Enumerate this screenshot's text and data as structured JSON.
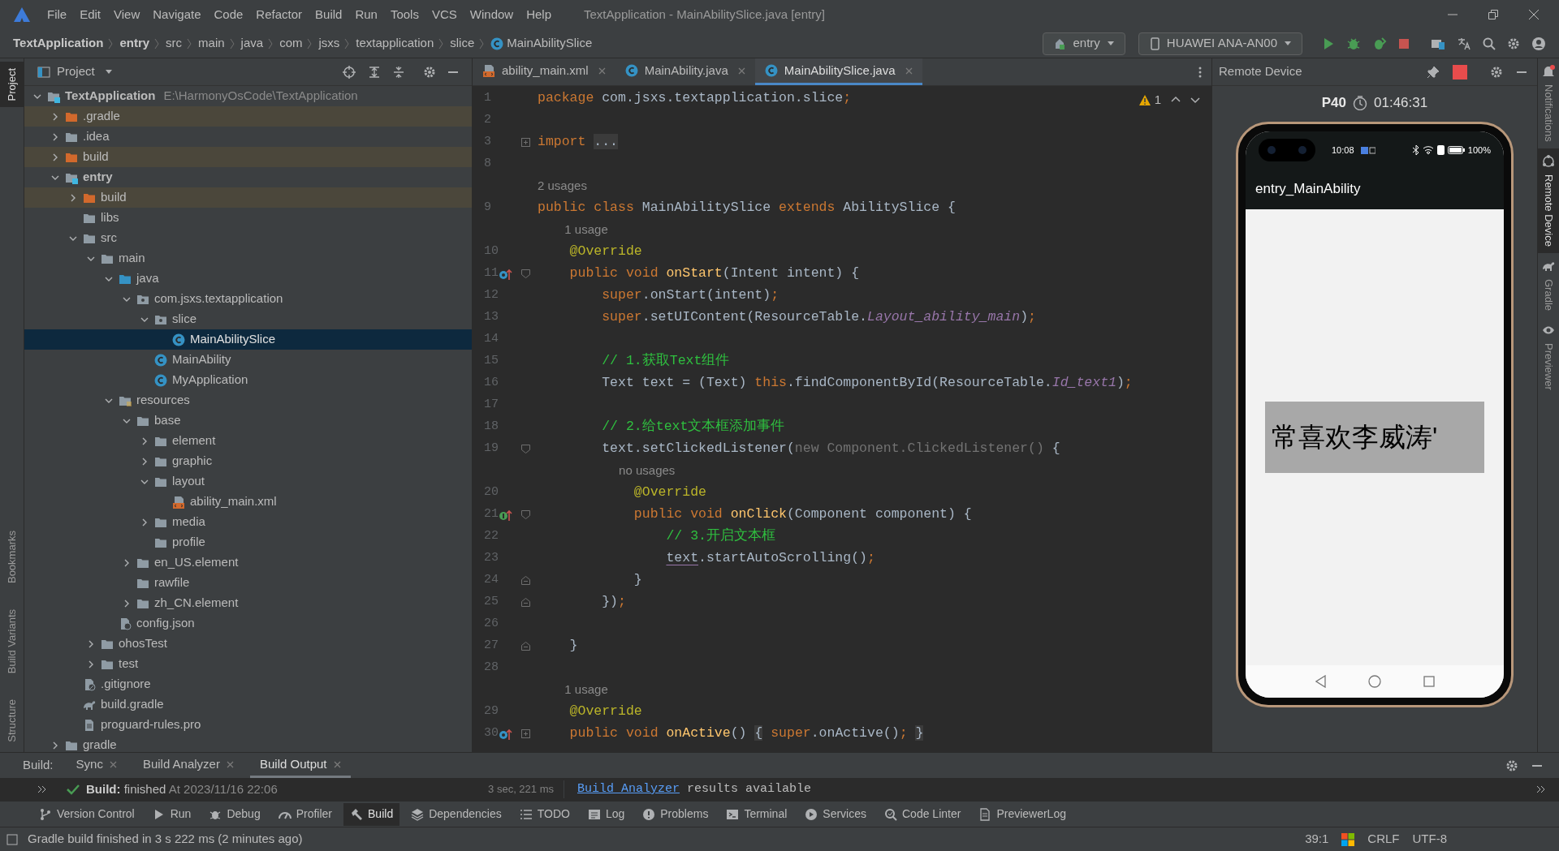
{
  "window_title": "TextApplication - MainAbilitySlice.java [entry]",
  "menu": [
    "File",
    "Edit",
    "View",
    "Navigate",
    "Code",
    "Refactor",
    "Build",
    "Run",
    "Tools",
    "VCS",
    "Window",
    "Help"
  ],
  "breadcrumb": [
    {
      "label": "TextApplication",
      "bold": true
    },
    {
      "label": "entry",
      "bold": true
    },
    {
      "label": "src",
      "bold": false
    },
    {
      "label": "main",
      "bold": false
    },
    {
      "label": "java",
      "bold": false
    },
    {
      "label": "com",
      "bold": false
    },
    {
      "label": "jsxs",
      "bold": false
    },
    {
      "label": "textapplication",
      "bold": false
    },
    {
      "label": "slice",
      "bold": false
    },
    {
      "label": "MainAbilitySlice",
      "bold": false,
      "kind": "class"
    }
  ],
  "run_config": "entry",
  "device": "HUAWEI ANA-AN00",
  "left_stripe_top": [
    {
      "label": "Project",
      "selected": true
    }
  ],
  "left_stripe_bottom": [
    {
      "label": "Bookmarks",
      "selected": false
    },
    {
      "label": "Build Variants",
      "selected": false
    },
    {
      "label": "Structure",
      "selected": false
    }
  ],
  "project_panel": {
    "title": "Project",
    "tree": [
      {
        "label": "TextApplication",
        "path": "E:\\HarmonyOsCode\\TextApplication",
        "kind": "module",
        "expanded": true,
        "selected": false,
        "children": [
          {
            "label": ".gradle",
            "kind": "excluded",
            "expanded": false,
            "selected": false
          },
          {
            "label": ".idea",
            "kind": "folder",
            "expanded": false,
            "selected": false
          },
          {
            "label": "build",
            "kind": "excluded",
            "expanded": false,
            "selected": false
          },
          {
            "label": "entry",
            "kind": "module",
            "expanded": true,
            "selected": false,
            "children": [
              {
                "label": "build",
                "kind": "excluded",
                "expanded": false,
                "selected": false
              },
              {
                "label": "libs",
                "kind": "folder",
                "selected": false
              },
              {
                "label": "src",
                "kind": "folder",
                "expanded": true,
                "selected": false,
                "children": [
                  {
                    "label": "main",
                    "kind": "folder",
                    "expanded": true,
                    "selected": false,
                    "children": [
                      {
                        "label": "java",
                        "kind": "source",
                        "expanded": true,
                        "selected": false,
                        "children": [
                          {
                            "label": "com.jsxs.textapplication",
                            "kind": "package",
                            "expanded": true,
                            "selected": false,
                            "children": [
                              {
                                "label": "slice",
                                "kind": "package",
                                "expanded": true,
                                "selected": false,
                                "children": [
                                  {
                                    "label": "MainAbilitySlice",
                                    "kind": "class",
                                    "selected": true
                                  }
                                ]
                              },
                              {
                                "label": "MainAbility",
                                "kind": "class",
                                "selected": false
                              },
                              {
                                "label": "MyApplication",
                                "kind": "class",
                                "selected": false
                              }
                            ]
                          }
                        ]
                      },
                      {
                        "label": "resources",
                        "kind": "resources",
                        "expanded": true,
                        "selected": false,
                        "children": [
                          {
                            "label": "base",
                            "kind": "folder",
                            "expanded": true,
                            "selected": false,
                            "children": [
                              {
                                "label": "element",
                                "kind": "folder",
                                "expanded": false,
                                "selected": false
                              },
                              {
                                "label": "graphic",
                                "kind": "folder",
                                "expanded": false,
                                "selected": false
                              },
                              {
                                "label": "layout",
                                "kind": "folder",
                                "expanded": true,
                                "selected": false,
                                "children": [
                                  {
                                    "label": "ability_main.xml",
                                    "kind": "xml",
                                    "selected": false
                                  }
                                ]
                              },
                              {
                                "label": "media",
                                "kind": "folder",
                                "expanded": false,
                                "selected": false
                              },
                              {
                                "label": "profile",
                                "kind": "folder",
                                "selected": false
                              }
                            ]
                          },
                          {
                            "label": "en_US.element",
                            "kind": "folder",
                            "expanded": false,
                            "selected": false
                          },
                          {
                            "label": "rawfile",
                            "kind": "folder",
                            "selected": false
                          },
                          {
                            "label": "zh_CN.element",
                            "kind": "folder",
                            "expanded": false,
                            "selected": false
                          }
                        ]
                      },
                      {
                        "label": "config.json",
                        "kind": "json",
                        "selected": false
                      }
                    ]
                  },
                  {
                    "label": "ohosTest",
                    "kind": "folder",
                    "expanded": false,
                    "selected": false
                  },
                  {
                    "label": "test",
                    "kind": "folder",
                    "expanded": false,
                    "selected": false
                  }
                ]
              },
              {
                "label": ".gitignore",
                "kind": "ignore",
                "selected": false
              },
              {
                "label": "build.gradle",
                "kind": "gradle",
                "selected": false
              },
              {
                "label": "proguard-rules.pro",
                "kind": "file",
                "selected": false
              }
            ]
          },
          {
            "label": "gradle",
            "kind": "folder",
            "expanded": false,
            "selected": false
          }
        ]
      }
    ]
  },
  "editor": {
    "tabs": [
      {
        "label": "ability_main.xml",
        "kind": "xml",
        "selected": false
      },
      {
        "label": "MainAbility.java",
        "kind": "class",
        "selected": false
      },
      {
        "label": "MainAbilitySlice.java",
        "kind": "class",
        "selected": true
      }
    ],
    "warnings": "1",
    "lines": [
      {
        "number": "1",
        "segments": [
          {
            "kind": "keyword",
            "text": "package "
          },
          {
            "kind": "plain",
            "text": "com.jsxs.textapplication.slice"
          },
          {
            "kind": "keyword",
            "text": ";"
          }
        ]
      },
      {
        "number": "2"
      },
      {
        "number": "3",
        "gutter": [
          {
            "kind": "fold-collapsed"
          }
        ],
        "segments": [
          {
            "kind": "keyword",
            "text": "import "
          },
          {
            "kind": "folded",
            "text": "..."
          }
        ]
      },
      {
        "number": "8"
      },
      {
        "number": "9",
        "hint": "2 usages",
        "segments": [
          {
            "kind": "keyword",
            "text": "public class "
          },
          {
            "kind": "plain",
            "text": "MainAbilitySlice "
          },
          {
            "kind": "keyword",
            "text": "extends "
          },
          {
            "kind": "plain",
            "text": "AbilitySlice {"
          }
        ]
      },
      {
        "number": "10",
        "hint": "1 usage",
        "segments": [
          {
            "kind": "annotation",
            "text": "    @Override"
          }
        ]
      },
      {
        "number": "11",
        "gutter": [
          {
            "kind": "override"
          },
          {
            "kind": "fold-start"
          }
        ],
        "segments": [
          {
            "kind": "keyword",
            "text": "    public void "
          },
          {
            "kind": "method",
            "text": "onStart"
          },
          {
            "kind": "plain",
            "text": "(Intent intent) {"
          }
        ]
      },
      {
        "number": "12",
        "segments": [
          {
            "kind": "keyword",
            "text": "        super"
          },
          {
            "kind": "plain",
            "text": ".onStart(intent)"
          },
          {
            "kind": "keyword",
            "text": ";"
          }
        ]
      },
      {
        "number": "13",
        "segments": [
          {
            "kind": "keyword",
            "text": "        super"
          },
          {
            "kind": "plain",
            "text": ".setUIContent(ResourceTable."
          },
          {
            "kind": "field",
            "text": "Layout_ability_main"
          },
          {
            "kind": "plain",
            "text": ")"
          },
          {
            "kind": "keyword",
            "text": ";"
          }
        ]
      },
      {
        "number": "14"
      },
      {
        "number": "15",
        "segments": [
          {
            "kind": "comment",
            "text": "        // 1.获取Text组件"
          }
        ]
      },
      {
        "number": "16",
        "segments": [
          {
            "kind": "plain",
            "text": "        Text text = (Text) "
          },
          {
            "kind": "keyword",
            "text": "this"
          },
          {
            "kind": "plain",
            "text": ".findComponentById(ResourceTable."
          },
          {
            "kind": "field",
            "text": "Id_text1"
          },
          {
            "kind": "plain",
            "text": ")"
          },
          {
            "kind": "keyword",
            "text": ";"
          }
        ]
      },
      {
        "number": "17"
      },
      {
        "number": "18",
        "segments": [
          {
            "kind": "comment",
            "text": "        // 2.给text文本框添加事件"
          }
        ]
      },
      {
        "number": "19",
        "gutter": [
          {
            "kind": "fold-start"
          }
        ],
        "segments": [
          {
            "kind": "plain",
            "text": "        text.setClickedListener("
          },
          {
            "kind": "dim",
            "text": "new Component.ClickedListener()"
          },
          {
            "kind": "plain",
            "text": " {"
          }
        ]
      },
      {
        "number": "20",
        "hint": "no usages",
        "segments": [
          {
            "kind": "annotation",
            "text": "            @Override"
          }
        ]
      },
      {
        "number": "21",
        "gutter": [
          {
            "kind": "implement"
          },
          {
            "kind": "fold-start"
          }
        ],
        "segments": [
          {
            "kind": "keyword",
            "text": "            public void "
          },
          {
            "kind": "method",
            "text": "onClick"
          },
          {
            "kind": "plain",
            "text": "(Component component) {"
          }
        ]
      },
      {
        "number": "22",
        "segments": [
          {
            "kind": "comment",
            "text": "                // 3.开启文本框"
          }
        ]
      },
      {
        "number": "23",
        "segments": [
          {
            "kind": "captured",
            "text": "                text"
          },
          {
            "kind": "plain",
            "text": ".startAutoScrolling()"
          },
          {
            "kind": "keyword",
            "text": ";"
          }
        ]
      },
      {
        "number": "24",
        "gutter": [
          {
            "kind": "fold-end"
          }
        ],
        "segments": [
          {
            "kind": "plain",
            "text": "            }"
          }
        ]
      },
      {
        "number": "25",
        "gutter": [
          {
            "kind": "fold-end"
          }
        ],
        "segments": [
          {
            "kind": "plain",
            "text": "        })"
          },
          {
            "kind": "keyword",
            "text": ";"
          }
        ]
      },
      {
        "number": "26"
      },
      {
        "number": "27",
        "gutter": [
          {
            "kind": "fold-end"
          }
        ],
        "segments": [
          {
            "kind": "plain",
            "text": "    }"
          }
        ]
      },
      {
        "number": "28"
      },
      {
        "number": "29",
        "hint": "1 usage",
        "segments": [
          {
            "kind": "annotation",
            "text": "    @Override"
          }
        ]
      },
      {
        "number": "30",
        "gutter": [
          {
            "kind": "override"
          },
          {
            "kind": "fold-collapsed"
          }
        ],
        "segments": [
          {
            "kind": "keyword",
            "text": "    public void "
          },
          {
            "kind": "method",
            "text": "onActive"
          },
          {
            "kind": "plain",
            "text": "() "
          },
          {
            "kind": "folded",
            "text": "{"
          },
          {
            "kind": "keyword",
            "text": " super"
          },
          {
            "kind": "plain",
            "text": ".onActive()"
          },
          {
            "kind": "keyword",
            "text": "; "
          },
          {
            "kind": "folded",
            "text": "}"
          }
        ]
      }
    ]
  },
  "remote_device": {
    "title": "Remote Device",
    "device": "P40",
    "timer": "01:46:31",
    "phone": {
      "time": "10:08",
      "battery": "100%",
      "app_title": "entry_MainAbility",
      "text_box": "常喜欢李威涛'"
    }
  },
  "right_stripe": [
    {
      "label": "Notifications",
      "kind": "bell",
      "selected": false
    },
    {
      "label": "Remote Device",
      "kind": "device",
      "selected": true
    },
    {
      "label": "Gradle",
      "kind": "gradle",
      "selected": false
    },
    {
      "label": "Previewer",
      "kind": "eye",
      "selected": false
    }
  ],
  "build_panel": {
    "label": "Build:",
    "tabs": [
      {
        "label": "Sync",
        "selected": false
      },
      {
        "label": "Build Analyzer",
        "selected": false
      },
      {
        "label": "Build Output",
        "selected": true
      }
    ],
    "status": "Build:",
    "result": "finished",
    "time": "At 2023/11/16 22:06",
    "duration": "3 sec, 221 ms",
    "link": "Build Analyzer",
    "message": "results available"
  },
  "tool_strip": [
    {
      "label": "Version Control",
      "kind": "branch",
      "selected": false
    },
    {
      "label": "Run",
      "kind": "play",
      "selected": false
    },
    {
      "label": "Debug",
      "kind": "bug",
      "selected": false
    },
    {
      "label": "Profiler",
      "kind": "gauge",
      "selected": false
    },
    {
      "label": "Build",
      "kind": "hammer",
      "selected": true
    },
    {
      "label": "Dependencies",
      "kind": "layers",
      "selected": false
    },
    {
      "label": "TODO",
      "kind": "list",
      "selected": false
    },
    {
      "label": "Log",
      "kind": "log",
      "selected": false
    },
    {
      "label": "Problems",
      "kind": "alert",
      "selected": false
    },
    {
      "label": "Terminal",
      "kind": "terminal",
      "selected": false
    },
    {
      "label": "Services",
      "kind": "play-circle",
      "selected": false
    },
    {
      "label": "Code Linter",
      "kind": "lint",
      "selected": false
    },
    {
      "label": "PreviewerLog",
      "kind": "doc",
      "selected": false
    }
  ],
  "status_bar": {
    "message": "Gradle build finished in 3 s 222 ms (2 minutes ago)",
    "position": "39:1",
    "line_separator": "CRLF",
    "encoding": "UTF-8"
  }
}
